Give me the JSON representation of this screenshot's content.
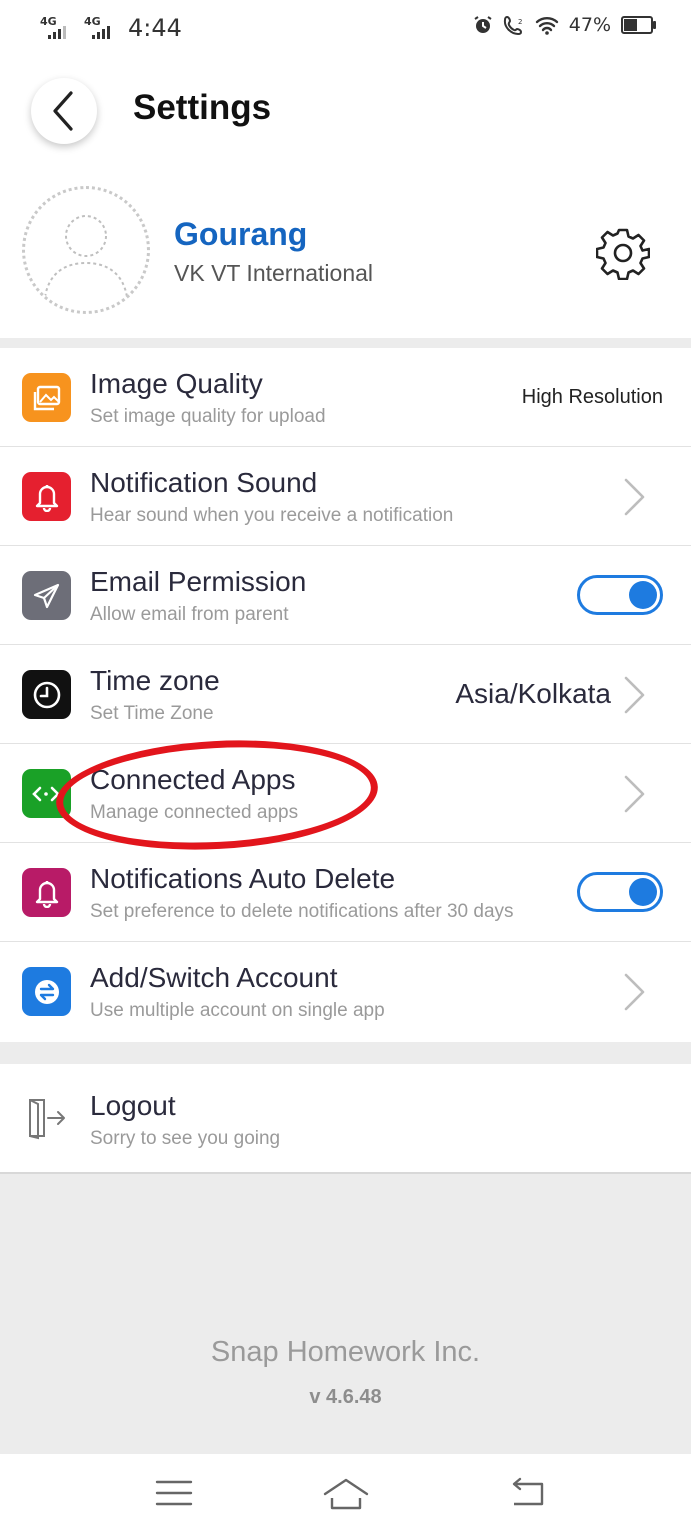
{
  "status_bar": {
    "network1": "4G",
    "network2": "4G",
    "time": "4:44",
    "battery": "47%",
    "battery_level": 0.47,
    "icons": [
      "alarm-icon",
      "volte-call-icon",
      "wifi-icon",
      "battery-icon"
    ]
  },
  "header": {
    "title": "Settings",
    "back_icon": "chevron-left-icon"
  },
  "profile": {
    "name": "Gourang",
    "organization": "VK VT International",
    "settings_icon": "gear-icon"
  },
  "settings": [
    {
      "id": "image-quality",
      "title": "Image Quality",
      "subtitle": "Set image quality for upload",
      "value": "High Resolution",
      "icon": "image-icon",
      "icon_color": "#f7931e",
      "control": "value"
    },
    {
      "id": "notification-sound",
      "title": "Notification Sound",
      "subtitle": "Hear sound when you receive a notification",
      "icon": "bell-icon",
      "icon_color": "#e5202f",
      "control": "chevron"
    },
    {
      "id": "email-permission",
      "title": "Email Permission",
      "subtitle": "Allow email from parent",
      "icon": "paper-plane-icon",
      "icon_color": "#6d6e78",
      "control": "toggle",
      "enabled": true
    },
    {
      "id": "time-zone",
      "title": "Time zone",
      "subtitle": "Set Time Zone",
      "value": "Asia/Kolkata",
      "icon": "clock-icon",
      "icon_color": "#111111",
      "control": "value-chevron"
    },
    {
      "id": "connected-apps",
      "title": "Connected Apps",
      "subtitle": "Manage connected apps",
      "icon": "connected-apps-icon",
      "icon_color": "#1aa127",
      "control": "chevron"
    },
    {
      "id": "notifications-auto-delete",
      "title": "Notifications Auto Delete",
      "subtitle": "Set preference to delete notifications after 30 days",
      "icon": "bell-icon",
      "icon_color": "#b81b67",
      "control": "toggle",
      "enabled": true
    },
    {
      "id": "add-switch-account",
      "title": "Add/Switch Account",
      "subtitle": "Use multiple account on single app",
      "icon": "switch-account-icon",
      "icon_color": "#1e7be0",
      "control": "chevron"
    }
  ],
  "logout": {
    "title": "Logout",
    "subtitle": "Sorry to see you going",
    "icon": "logout-icon"
  },
  "footer": {
    "company": "Snap Homework Inc.",
    "version": "v 4.6.48"
  },
  "nav_bar": {
    "icons": [
      "menu-icon",
      "home-icon",
      "back-icon"
    ]
  },
  "colors": {
    "accent": "#1e7be0",
    "name": "#1565c0",
    "annotation": "#e2151c",
    "background_gray": "#ececec"
  }
}
